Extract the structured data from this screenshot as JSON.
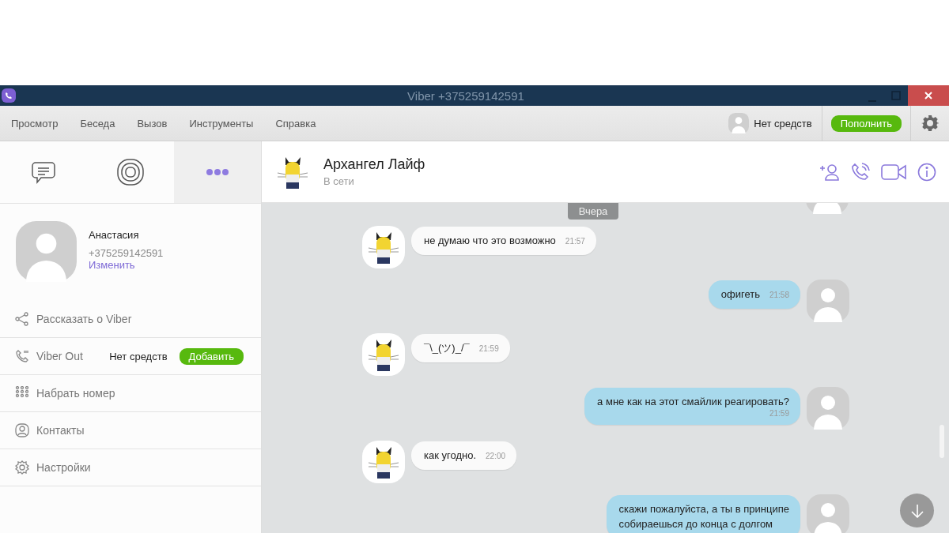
{
  "window": {
    "title": "Viber +375259142591"
  },
  "menu": [
    "Просмотр",
    "Беседа",
    "Вызов",
    "Инструменты",
    "Справка"
  ],
  "account": {
    "balance": "Нет средств",
    "topup_button": "Пополнить"
  },
  "sidebar_tabs": [
    {
      "kind": "chats",
      "selected": false
    },
    {
      "kind": "public",
      "selected": false
    },
    {
      "kind": "more",
      "selected": true
    }
  ],
  "profile": {
    "name": "Анастасия",
    "phone": "+375259142591",
    "edit_link": "Изменить"
  },
  "sidebar_items": [
    {
      "kind": "share",
      "label": "Рассказать о Viber"
    },
    {
      "kind": "viber_out",
      "label": "Viber Out",
      "status": "Нет средств",
      "button": "Добавить"
    },
    {
      "kind": "dial",
      "label": "Набрать номер"
    },
    {
      "kind": "contacts",
      "label": "Контакты"
    },
    {
      "kind": "settings",
      "label": "Настройки"
    }
  ],
  "chat": {
    "name": "Архангел Лайф",
    "status": "В сети",
    "day_label": "Вчера",
    "messages": [
      {
        "kind": "incoming",
        "text": "не думаю что это возможно",
        "time": "21:57"
      },
      {
        "kind": "outgoing",
        "text": "офигеть",
        "time": "21:58"
      },
      {
        "kind": "incoming",
        "text": "¯\\_(ツ)_/¯",
        "time": "21:59"
      },
      {
        "kind": "outgoing",
        "text": "а мне как на этот смайлик реагировать?",
        "time": "21:59",
        "time_below": true
      },
      {
        "kind": "incoming",
        "text": "как угодно.",
        "time": "22:00"
      },
      {
        "kind": "outgoing",
        "lines": [
          "скажи пожалуйста, а ты в принципе",
          "собираешься до конца с долгом"
        ]
      }
    ]
  }
}
